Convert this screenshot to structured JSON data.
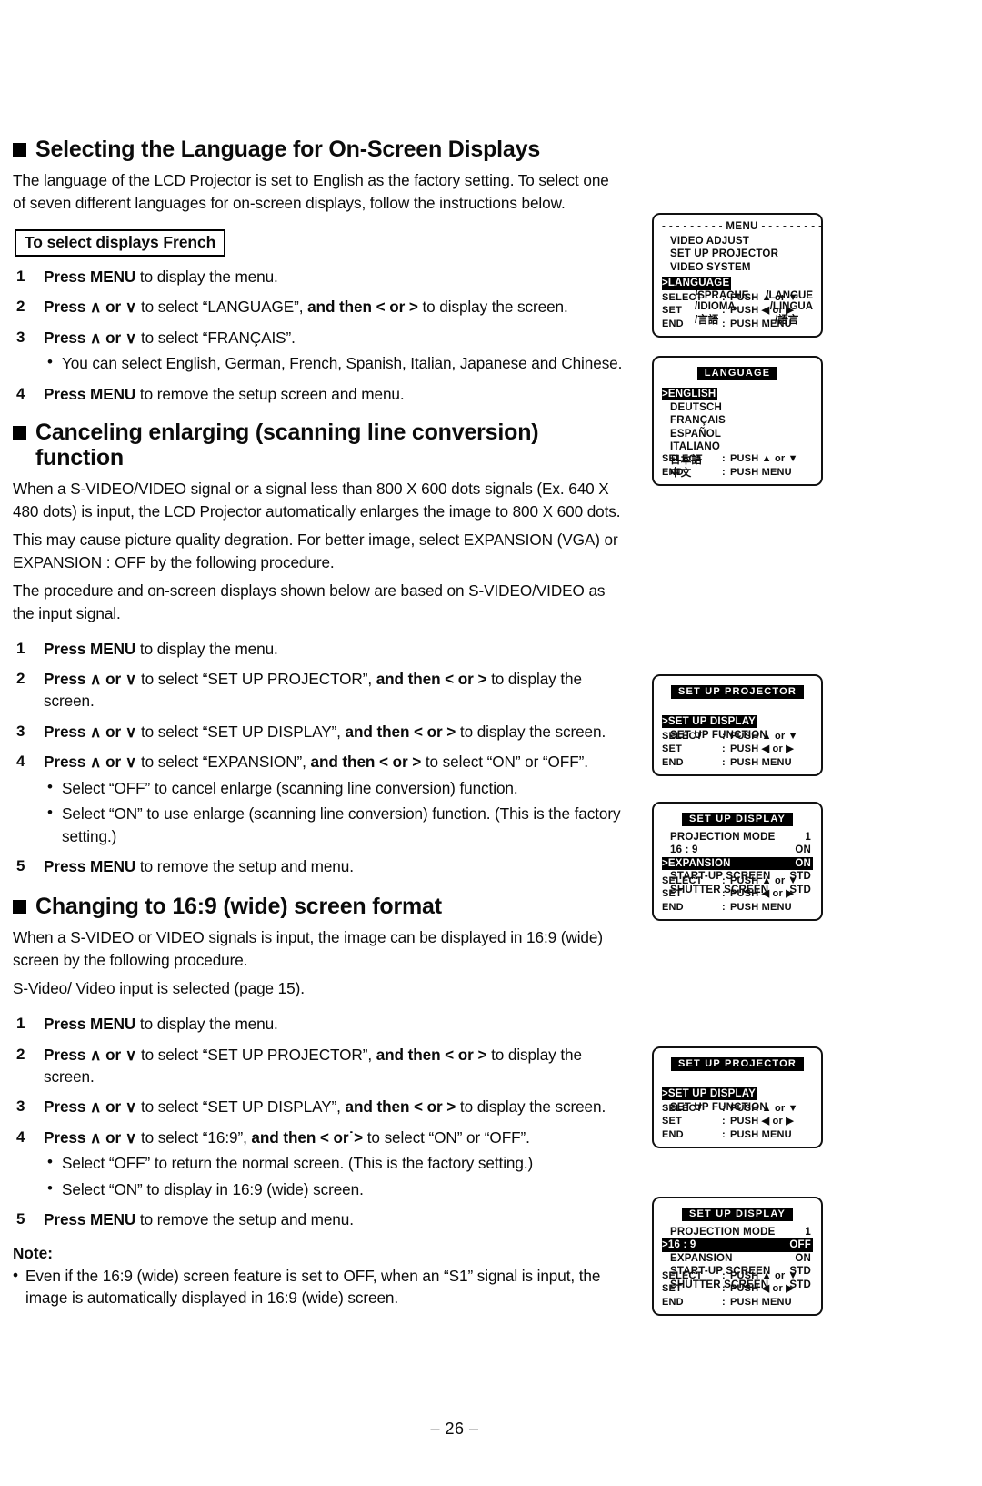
{
  "page": {
    "number": "– 26 –"
  },
  "sections": [
    {
      "id": "language",
      "heading": "Selecting the Language for On-Screen Displays",
      "intro": "The language of the LCD Projector is set to English as the factory setting. To select one of seven different languages for on-screen displays, follow the instructions below.",
      "boxed_label": "To select displays French",
      "steps": [
        {
          "num": "1",
          "text_html": "<b>Press MENU</b> to display the menu."
        },
        {
          "num": "2",
          "text_html": "<b>Press ∧ or ∨</b> to select “LANGUAGE”,  <b>and then &lt; or &gt;</b> to display the screen."
        },
        {
          "num": "3",
          "text_html": "<b>Press ∧ or ∨</b> to select “FRANÇAIS”."
        },
        {
          "num": "4",
          "text_html": "<b>Press MENU</b> to remove the setup screen and menu."
        }
      ],
      "bullets_after_step3": [
        "You can select English, German, French, Spanish, Italian, Japanese and Chinese."
      ]
    },
    {
      "id": "canceling-enlarging",
      "heading": "Canceling enlarging (scanning line conversion) function",
      "paragraphs": [
        "When a S-VIDEO/VIDEO signal or a signal less than 800 X 600 dots signals (Ex. 640 X 480 dots) is input, the LCD Projector automatically enlarges the image to 800 X 600 dots.",
        "This may cause picture quality degration. For better image, select EXPANSION (VGA) or EXPANSION : OFF by the following procedure.",
        "The procedure and on-screen displays shown below are based on S-VIDEO/VIDEO as the input signal."
      ],
      "steps": [
        {
          "num": "1",
          "text_html": "<b>Press MENU</b> to display the menu."
        },
        {
          "num": "2",
          "text_html": "<b>Press ∧ or ∨</b> to select “SET UP PROJECTOR”,  <b>and then &lt; or &gt;</b> to display the screen."
        },
        {
          "num": "3",
          "text_html": "<b>Press ∧ or ∨</b> to select “SET UP DISPLAY”,  <b>and then &lt; or &gt;</b> to display the screen."
        },
        {
          "num": "4",
          "text_html": "<b>Press ∧ or ∨</b> to select “EXPANSION”, <b>and then &lt; or &gt;</b> to select “ON” or “OFF”."
        },
        {
          "num": "5",
          "text_html": "<b>Press MENU</b> to remove the setup and menu."
        }
      ],
      "bullets_after_step4": [
        "Select “OFF” to cancel enlarge (scanning line conversion) function.",
        "Select “ON” to use enlarge (scanning line conversion) function. (This is the factory setting.)"
      ]
    },
    {
      "id": "wide-screen",
      "heading": "Changing to 16:9 (wide) screen format",
      "paragraphs": [
        "When a S-VIDEO or VIDEO signals is input, the image can be displayed in 16:9 (wide) screen by the following procedure.",
        "S-Video/ Video input is selected (page 15)."
      ],
      "steps": [
        {
          "num": "1",
          "text_html": "<b>Press MENU</b> to display the menu."
        },
        {
          "num": "2",
          "text_html": "<b>Press ∧ or ∨</b> to select “SET UP PROJECTOR”,  <b>and then &lt; or &gt;</b> to display the screen."
        },
        {
          "num": "3",
          "text_html": "<b>Press ∧ or ∨</b> to select “SET UP DISPLAY”,  <b>and then &lt; or &gt;</b> to display the screen."
        },
        {
          "num": "4",
          "text_html": "<b>Press ∧ or ∨</b> to select “16:9”, <b>and then &lt; or˙&gt;</b> to select “ON” or “OFF”."
        },
        {
          "num": "5",
          "text_html": "<b>Press MENU</b> to remove the setup and menu."
        }
      ],
      "bullets_after_step4": [
        "Select “OFF” to return the normal screen. (This is the factory setting.)",
        "Select “ON” to display in 16:9 (wide) screen."
      ],
      "note_heading": "Note:",
      "note_items": [
        "Even if the 16:9 (wide) screen feature is set to OFF, when an “S1” signal is input, the image is automatically displayed in 16:9 (wide) screen."
      ]
    }
  ],
  "osd_screens": [
    {
      "id": "menu",
      "title_dashed": "- - - - - - - - -  MENU  - - - - - - - - -",
      "items": [
        {
          "label": "VIDEO ADJUST",
          "selected": false
        },
        {
          "label": "SET UP PROJECTOR",
          "selected": false
        },
        {
          "label": "VIDEO SYSTEM",
          "selected": false
        },
        {
          "label": ">LANGUAGE",
          "selected": true
        }
      ],
      "lang_aliases": [
        {
          "left": "/SPRACHE",
          "right": "/LANGUE"
        },
        {
          "left": "/IDIOMA",
          "right": "/LINGUA"
        },
        {
          "left": "/言語",
          "right": "/語言"
        }
      ],
      "footer": [
        {
          "key": "SELECT",
          "sep": ":",
          "value": "PUSH ▲ or ▼"
        },
        {
          "key": "SET",
          "sep": ":",
          "value": "PUSH ◀ or ▶"
        },
        {
          "key": "END",
          "sep": ":",
          "value": "PUSH MENU"
        }
      ]
    },
    {
      "id": "language",
      "title_inv": "LANGUAGE",
      "items": [
        {
          "label": ">ENGLISH",
          "selected": true
        },
        {
          "label": "DEUTSCH",
          "selected": false
        },
        {
          "label": "FRANÇAIS",
          "selected": false
        },
        {
          "label": "ESPAÑOL",
          "selected": false
        },
        {
          "label": "ITALIANO",
          "selected": false
        },
        {
          "label": "日本語",
          "selected": false
        },
        {
          "label": "中文",
          "selected": false
        }
      ],
      "footer": [
        {
          "key": "SELECT",
          "sep": ":",
          "value": "PUSH ▲ or ▼"
        },
        {
          "key": "END",
          "sep": ":",
          "value": "PUSH MENU"
        }
      ]
    },
    {
      "id": "setup-projector-1",
      "title_inv": "SET UP PROJECTOR",
      "items": [
        {
          "label": ">SET UP DISPLAY",
          "selected": true
        },
        {
          "label": "SET UP FUNCTION",
          "selected": false
        }
      ],
      "footer": [
        {
          "key": "SELECT",
          "sep": ":",
          "value": "PUSH ▲ or ▼"
        },
        {
          "key": "SET",
          "sep": ":",
          "value": "PUSH ◀ or ▶"
        },
        {
          "key": "END",
          "sep": ":",
          "value": "PUSH MENU"
        }
      ]
    },
    {
      "id": "setup-display-expansion",
      "title_inv": "SET UP DISPLAY",
      "rows": [
        {
          "label": "PROJECTION MODE",
          "value": "1",
          "selected": false
        },
        {
          "label": "16 : 9",
          "value": "ON",
          "selected": false
        },
        {
          "label": ">EXPANSION",
          "value": "ON",
          "selected": true
        },
        {
          "label": "START-UP SCREEN",
          "value": "STD",
          "selected": false
        },
        {
          "label": "SHUTTER SCREEN",
          "value": "STD",
          "selected": false
        }
      ],
      "footer": [
        {
          "key": "SELECT",
          "sep": ":",
          "value": "PUSH ▲ or ▼"
        },
        {
          "key": "SET",
          "sep": ":",
          "value": "PUSH ◀ or ▶"
        },
        {
          "key": "END",
          "sep": ":",
          "value": "PUSH MENU"
        }
      ]
    },
    {
      "id": "setup-projector-2",
      "title_inv": "SET UP PROJECTOR",
      "items": [
        {
          "label": ">SET UP DISPLAY",
          "selected": true
        },
        {
          "label": "SET UP FUNCTION",
          "selected": false
        }
      ],
      "footer": [
        {
          "key": "SELECT",
          "sep": ":",
          "value": "PUSH ▲ or ▼"
        },
        {
          "key": "SET",
          "sep": ":",
          "value": "PUSH ◀ or ▶"
        },
        {
          "key": "END",
          "sep": ":",
          "value": "PUSH MENU"
        }
      ]
    },
    {
      "id": "setup-display-169",
      "title_inv": "SET UP DISPLAY",
      "rows": [
        {
          "label": "PROJECTION MODE",
          "value": "1",
          "selected": false
        },
        {
          "label": ">16 : 9",
          "value": "OFF",
          "selected": true
        },
        {
          "label": "EXPANSION",
          "value": "ON",
          "selected": false
        },
        {
          "label": "START-UP SCREEN",
          "value": "STD",
          "selected": false
        },
        {
          "label": "SHUTTER SCREEN",
          "value": "STD",
          "selected": false
        }
      ],
      "footer": [
        {
          "key": "SELECT",
          "sep": ":",
          "value": "PUSH ▲ or ▼"
        },
        {
          "key": "SET",
          "sep": ":",
          "value": "PUSH ◀ or ▶"
        },
        {
          "key": "END",
          "sep": ":",
          "value": "PUSH MENU"
        }
      ]
    }
  ]
}
